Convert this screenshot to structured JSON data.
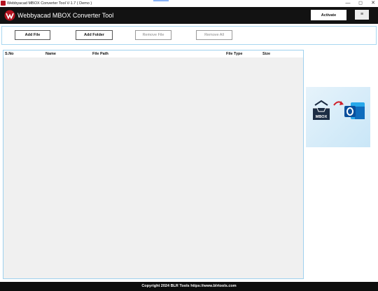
{
  "window": {
    "title": "Webbyacad MBOX Converter Tool V-1.7 ( Demo )",
    "controls": {
      "minimize": "—",
      "maximize": "◻",
      "close": "✕"
    }
  },
  "header": {
    "app_title": "Webbyacad MBOX Converter Tool",
    "activate_label": "Activate",
    "menu_label": "≡",
    "logo_icon": "webbyacad-logo-icon"
  },
  "toolbar": {
    "add_file_label": "Add File",
    "add_folder_label": "Add Folder",
    "remove_file_label": "Remove File",
    "remove_all_label": "Remove All"
  },
  "table": {
    "columns": [
      "S.No",
      "Name",
      "File Path",
      "File Type",
      "Size"
    ],
    "rows": []
  },
  "illustration": {
    "source_label": "MBOX",
    "source_icon": "mbox-inbox-icon",
    "arrow_icon": "convert-arrow-icon",
    "target_icon": "outlook-icon"
  },
  "footer": {
    "text": "Copyright 2024 BLR Tools https://www.blrtools.com"
  },
  "colors": {
    "header_bg": "#121212",
    "accent_border": "#9fd1ee",
    "logo_red": "#b3121f",
    "outlook_blue": "#0f6cbd"
  }
}
